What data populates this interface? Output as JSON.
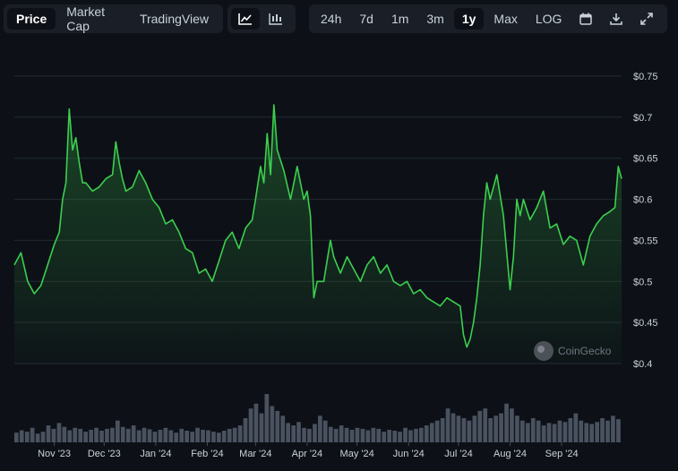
{
  "toolbar": {
    "metric_tabs": [
      "Price",
      "Market Cap",
      "TradingView"
    ],
    "active_metric": "Price",
    "chart_icons": [
      "line-chart-icon",
      "candlestick-chart-icon"
    ],
    "range_tabs": [
      "24h",
      "7d",
      "1m",
      "3m",
      "1y",
      "Max",
      "LOG"
    ],
    "active_range": "1y",
    "action_icons": [
      "calendar-icon",
      "download-icon",
      "expand-icon"
    ]
  },
  "watermark": "CoinGecko",
  "colors": {
    "background": "#0d1117",
    "line": "#3ccf4e",
    "grid": "#222a33",
    "text": "#c9d1d9"
  },
  "chart_data": {
    "type": "area",
    "title": "",
    "xlabel": "",
    "ylabel": "",
    "ylim": [
      0.4,
      0.75
    ],
    "grid": true,
    "y_ticks": [
      0.4,
      0.45,
      0.5,
      0.55,
      0.6,
      0.65,
      0.7,
      0.75
    ],
    "y_tick_labels": [
      "$0.4",
      "$0.45",
      "$0.5",
      "$0.55",
      "$0.6",
      "$0.65",
      "$0.7",
      "$0.75"
    ],
    "x_tick_labels": [
      "Nov '23",
      "Dec '23",
      "Jan '24",
      "Feb '24",
      "Mar '24",
      "Apr '24",
      "May '24",
      "Jun '24",
      "Jul '24",
      "Aug '24",
      "Sep '24"
    ],
    "x_tick_dates": [
      "2023-11-01",
      "2023-12-01",
      "2024-01-01",
      "2024-02-01",
      "2024-03-01",
      "2024-04-01",
      "2024-05-01",
      "2024-06-01",
      "2024-07-01",
      "2024-08-01",
      "2024-09-01"
    ],
    "x_range": [
      "2023-10-08",
      "2024-10-07"
    ],
    "series": [
      {
        "x": [
          "2023-10-08",
          "2023-10-12",
          "2023-10-16",
          "2023-10-20",
          "2023-10-24",
          "2023-10-28",
          "2023-11-01",
          "2023-11-04",
          "2023-11-06",
          "2023-11-08",
          "2023-11-10",
          "2023-11-12",
          "2023-11-14",
          "2023-11-16",
          "2023-11-18",
          "2023-11-20",
          "2023-11-24",
          "2023-11-28",
          "2023-12-02",
          "2023-12-06",
          "2023-12-08",
          "2023-12-10",
          "2023-12-12",
          "2023-12-14",
          "2023-12-18",
          "2023-12-22",
          "2023-12-26",
          "2023-12-30",
          "2024-01-03",
          "2024-01-07",
          "2024-01-11",
          "2024-01-15",
          "2024-01-19",
          "2024-01-23",
          "2024-01-27",
          "2024-01-31",
          "2024-02-04",
          "2024-02-08",
          "2024-02-12",
          "2024-02-16",
          "2024-02-20",
          "2024-02-24",
          "2024-02-28",
          "2024-03-01",
          "2024-03-04",
          "2024-03-06",
          "2024-03-08",
          "2024-03-10",
          "2024-03-12",
          "2024-03-14",
          "2024-03-18",
          "2024-03-22",
          "2024-03-26",
          "2024-03-28",
          "2024-03-30",
          "2024-04-01",
          "2024-04-03",
          "2024-04-05",
          "2024-04-07",
          "2024-04-11",
          "2024-04-13",
          "2024-04-15",
          "2024-04-17",
          "2024-04-21",
          "2024-04-25",
          "2024-04-29",
          "2024-05-03",
          "2024-05-07",
          "2024-05-11",
          "2024-05-15",
          "2024-05-19",
          "2024-05-23",
          "2024-05-27",
          "2024-05-31",
          "2024-06-04",
          "2024-06-08",
          "2024-06-12",
          "2024-06-16",
          "2024-06-20",
          "2024-06-24",
          "2024-06-28",
          "2024-07-02",
          "2024-07-04",
          "2024-07-06",
          "2024-07-08",
          "2024-07-10",
          "2024-07-12",
          "2024-07-14",
          "2024-07-16",
          "2024-07-18",
          "2024-07-20",
          "2024-07-22",
          "2024-07-24",
          "2024-07-28",
          "2024-08-01",
          "2024-08-03",
          "2024-08-05",
          "2024-08-07",
          "2024-08-09",
          "2024-08-13",
          "2024-08-17",
          "2024-08-21",
          "2024-08-25",
          "2024-08-29",
          "2024-09-02",
          "2024-09-06",
          "2024-09-10",
          "2024-09-14",
          "2024-09-18",
          "2024-09-22",
          "2024-09-26",
          "2024-09-30",
          "2024-10-03",
          "2024-10-05",
          "2024-10-07"
        ],
        "values": [
          0.52,
          0.535,
          0.5,
          0.485,
          0.495,
          0.52,
          0.545,
          0.56,
          0.6,
          0.62,
          0.71,
          0.66,
          0.675,
          0.645,
          0.62,
          0.62,
          0.61,
          0.615,
          0.625,
          0.63,
          0.67,
          0.645,
          0.625,
          0.61,
          0.615,
          0.635,
          0.62,
          0.6,
          0.59,
          0.57,
          0.575,
          0.56,
          0.54,
          0.535,
          0.51,
          0.515,
          0.5,
          0.525,
          0.55,
          0.56,
          0.54,
          0.565,
          0.575,
          0.6,
          0.64,
          0.62,
          0.68,
          0.63,
          0.715,
          0.66,
          0.635,
          0.6,
          0.64,
          0.62,
          0.6,
          0.61,
          0.58,
          0.48,
          0.5,
          0.5,
          0.525,
          0.55,
          0.53,
          0.51,
          0.53,
          0.515,
          0.5,
          0.52,
          0.53,
          0.51,
          0.52,
          0.5,
          0.495,
          0.5,
          0.485,
          0.49,
          0.48,
          0.475,
          0.47,
          0.48,
          0.475,
          0.47,
          0.435,
          0.42,
          0.43,
          0.45,
          0.48,
          0.52,
          0.58,
          0.62,
          0.6,
          0.615,
          0.63,
          0.58,
          0.49,
          0.53,
          0.6,
          0.58,
          0.6,
          0.575,
          0.59,
          0.61,
          0.565,
          0.57,
          0.545,
          0.555,
          0.55,
          0.52,
          0.555,
          0.57,
          0.58,
          0.585,
          0.59,
          0.64,
          0.625
        ]
      }
    ],
    "volume": [
      0.2,
      0.25,
      0.22,
      0.3,
      0.18,
      0.22,
      0.35,
      0.28,
      0.4,
      0.32,
      0.25,
      0.3,
      0.28,
      0.22,
      0.26,
      0.3,
      0.24,
      0.28,
      0.3,
      0.45,
      0.32,
      0.28,
      0.35,
      0.25,
      0.3,
      0.27,
      0.22,
      0.26,
      0.3,
      0.25,
      0.2,
      0.28,
      0.24,
      0.22,
      0.3,
      0.26,
      0.25,
      0.22,
      0.2,
      0.24,
      0.28,
      0.3,
      0.35,
      0.5,
      0.7,
      0.8,
      0.6,
      1.0,
      0.75,
      0.65,
      0.55,
      0.4,
      0.35,
      0.42,
      0.3,
      0.28,
      0.38,
      0.55,
      0.45,
      0.32,
      0.28,
      0.35,
      0.3,
      0.26,
      0.3,
      0.28,
      0.25,
      0.3,
      0.28,
      0.22,
      0.26,
      0.24,
      0.22,
      0.3,
      0.25,
      0.28,
      0.3,
      0.35,
      0.4,
      0.45,
      0.5,
      0.7,
      0.6,
      0.55,
      0.5,
      0.45,
      0.55,
      0.65,
      0.7,
      0.5,
      0.55,
      0.6,
      0.8,
      0.7,
      0.55,
      0.45,
      0.4,
      0.5,
      0.45,
      0.35,
      0.4,
      0.38,
      0.45,
      0.42,
      0.5,
      0.6,
      0.45,
      0.4,
      0.38,
      0.42,
      0.5,
      0.45,
      0.55,
      0.48
    ]
  }
}
